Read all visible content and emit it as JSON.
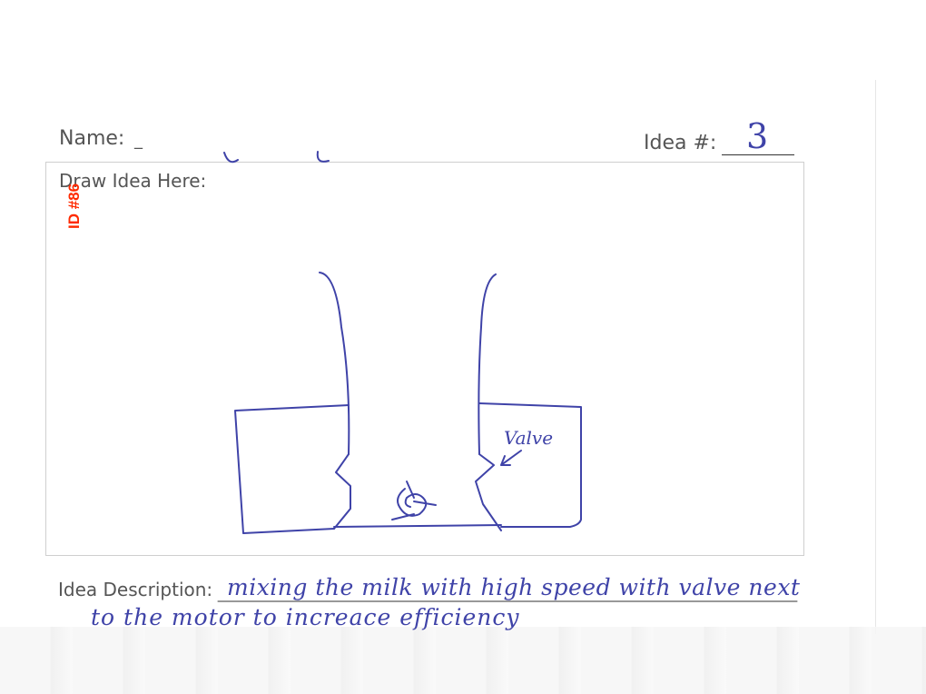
{
  "form": {
    "name_label": "Name:",
    "name_value": "_",
    "idea_label": "Idea #:",
    "idea_number": "3",
    "draw_label": "Draw Idea Here:",
    "description_label": "Idea Description:",
    "description_line1": "mixing the milk with high speed with valve next",
    "description_line2": "to the motor to increace efficiency"
  },
  "drawing": {
    "annotation": "Valve"
  },
  "stamp": {
    "id": "ID #86",
    "color": "#ff2a00"
  },
  "colors": {
    "ink": "#3f43a8",
    "print": "#555555"
  }
}
